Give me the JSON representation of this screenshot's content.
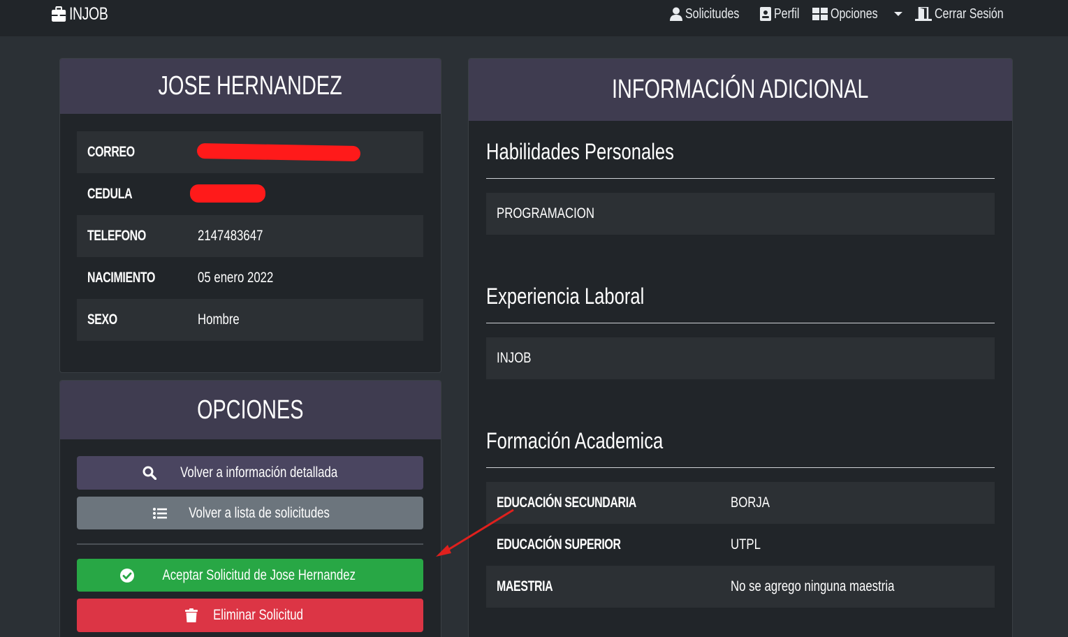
{
  "navbar": {
    "brand": "INJOB",
    "links": [
      {
        "label": "Solicitudes",
        "icon": "user-icon"
      },
      {
        "label": "Perfil",
        "icon": "id-badge-icon"
      },
      {
        "label": "Opciones",
        "icon": "grid-icon"
      },
      {
        "label": "Cerrar Sesión",
        "icon": "door-exit-icon"
      }
    ]
  },
  "profile": {
    "name": "JOSE HERNANDEZ",
    "fields": [
      {
        "label": "CORREO",
        "value": ""
      },
      {
        "label": "CEDULA",
        "value": ""
      },
      {
        "label": "TELEFONO",
        "value": "2147483647"
      },
      {
        "label": "NACIMIENTO",
        "value": "05 enero 2022"
      },
      {
        "label": "SEXO",
        "value": "Hombre"
      }
    ],
    "redaction_color": "#ff1a1a"
  },
  "options": {
    "title": "OPCIONES",
    "back_detail": "Volver a información detallada",
    "back_list": "Volver a lista de solicitudes",
    "accept": "Aceptar Solicitud de Jose Hernandez",
    "delete": "Eliminar Solicitud"
  },
  "additional": {
    "title": "INFORMACIÓN ADICIONAL",
    "skills_title": "Habilidades Personales",
    "skills": [
      "PROGRAMACION"
    ],
    "experience_title": "Experiencia Laboral",
    "experience": [
      "INJOB"
    ],
    "education_title": "Formación Academica",
    "education": [
      {
        "label": "EDUCACIÓN SECUNDARIA",
        "value": "BORJA"
      },
      {
        "label": "EDUCACIÓN SUPERIOR",
        "value": "UTPL"
      },
      {
        "label": "MAESTRIA",
        "value": "No se agrego ninguna maestria"
      }
    ]
  },
  "colors": {
    "background": "#2b3035",
    "navbar": "#212529",
    "card": "#212529",
    "card_header": "#3f3c50",
    "accept_button": "#28a745",
    "delete_button": "#dc3545",
    "secondary_button": "#6c757d",
    "annotation_arrow": "#e0201d"
  }
}
